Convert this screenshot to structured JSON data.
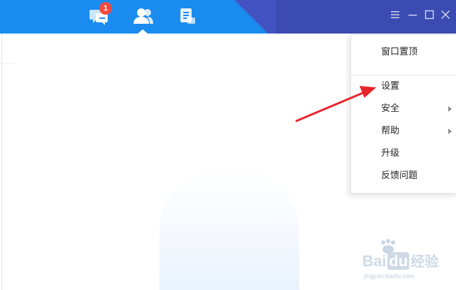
{
  "badge_count": "1",
  "menu": {
    "items": [
      {
        "label": "窗口置顶"
      },
      {
        "label": "设置"
      },
      {
        "label": "安全"
      },
      {
        "label": "帮助"
      },
      {
        "label": "升级"
      },
      {
        "label": "反馈问题"
      }
    ]
  },
  "icons": {
    "messages": "chat-icon",
    "contacts": "contacts-icon",
    "files": "document-icon",
    "menu": "hamburger-icon",
    "minimize": "minimize-icon",
    "maximize": "maximize-icon",
    "close": "close-icon"
  },
  "colors": {
    "titlebar": "#1a8cf0",
    "titlebar_dark": "#3b4bb2",
    "badge": "#f04a3e",
    "arrow": "#e8252a"
  },
  "watermark": {
    "brand_bai": "Bai",
    "brand_du": "du",
    "brand_cn": "经验",
    "url": "jingyan.baidu.com"
  }
}
